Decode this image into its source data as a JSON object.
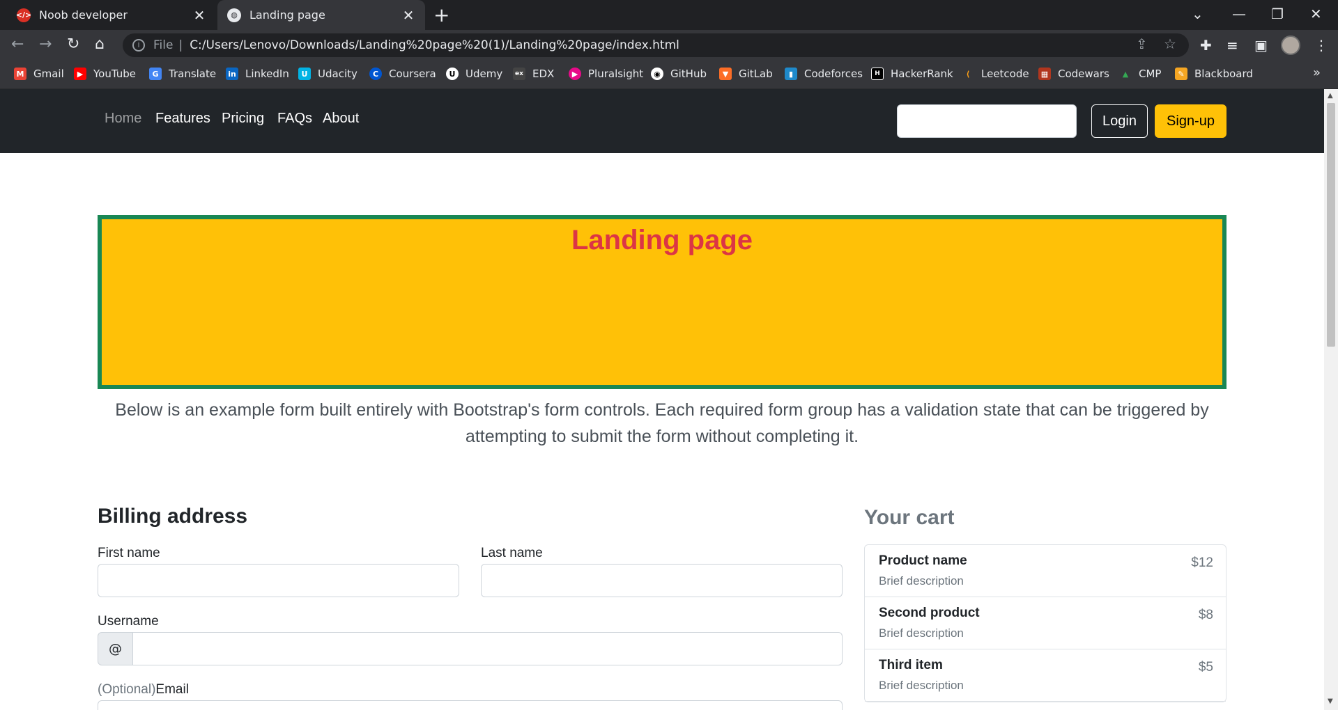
{
  "browser": {
    "tabs": [
      {
        "title": "Noob developer",
        "active": false
      },
      {
        "title": "Landing page",
        "active": true
      }
    ],
    "address": {
      "scheme_label": "File",
      "url": "C:/Users/Lenovo/Downloads/Landing%20page%20(1)/Landing%20page/index.html"
    },
    "bookmarks": [
      "Gmail",
      "YouTube",
      "Translate",
      "LinkedIn",
      "Udacity",
      "Coursera",
      "Udemy",
      "EDX",
      "Pluralsight",
      "GitHub",
      "GitLab",
      "Codeforces",
      "HackerRank",
      "Leetcode",
      "Codewars",
      "CMP",
      "Blackboard"
    ]
  },
  "nav": {
    "links": [
      "Home",
      "Features",
      "Pricing",
      "FAQs",
      "About"
    ],
    "search_value": "",
    "login": "Login",
    "signup": "Sign-up"
  },
  "hero": {
    "title": "Landing page"
  },
  "lead": "Below is an example form built entirely with Bootstrap's form controls. Each required form group has a validation state that can be triggered by attempting to submit the form without completing it.",
  "billing": {
    "title": "Billing address",
    "first_name": "First name",
    "last_name": "Last name",
    "username": "Username",
    "at": "@",
    "email_optional": "(Optional)",
    "email": "Email"
  },
  "cart": {
    "title": "Your cart",
    "items": [
      {
        "name": "Product name",
        "desc": "Brief description",
        "price": "$12"
      },
      {
        "name": "Second product",
        "desc": "Brief description",
        "price": "$8"
      },
      {
        "name": "Third item",
        "desc": "Brief description",
        "price": "$5"
      }
    ]
  },
  "colors": {
    "hero_bg": "#ffc107",
    "hero_border": "#198754",
    "hero_title": "#dc3545",
    "nav_bg": "#212529"
  }
}
